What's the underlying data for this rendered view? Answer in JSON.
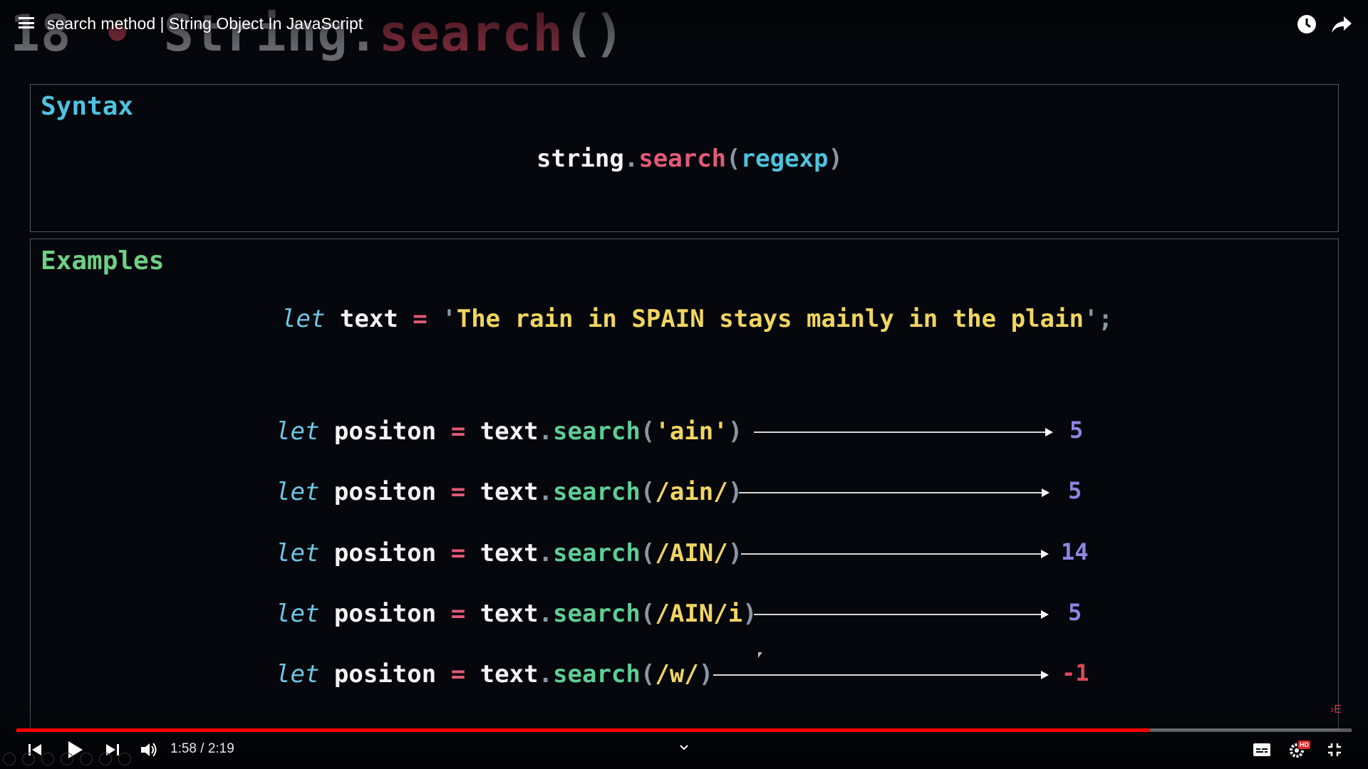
{
  "slide": {
    "heading_num": "18",
    "heading_dot": "•",
    "heading_obj": "String.",
    "heading_method": "search",
    "heading_paren": "()"
  },
  "player": {
    "title": "search method | String Object In JavaScript",
    "time": "1:58 / 2:19",
    "progress_fraction": 0.849,
    "hd_badge": "HD",
    "accent": "#ff0000"
  },
  "syntax": {
    "title": "Syntax",
    "obj": "string",
    "dot": ".",
    "method": "search",
    "open": "(",
    "arg": "regexp",
    "close": ")"
  },
  "examples": {
    "title": "Examples",
    "decl": {
      "kw": "let",
      "name": "text",
      "eq": "=",
      "q1": "'",
      "str": "The rain in SPAIN stays mainly in the plain",
      "q2": "'",
      "semi": ";"
    },
    "lines": [
      {
        "kw": "let",
        "var": "positon",
        "eq": "=",
        "obj": "text",
        "dot": ".",
        "method": "search",
        "open": "(",
        "arg": "'ain'",
        "close": ")",
        "result": "5"
      },
      {
        "kw": "let",
        "var": "positon",
        "eq": "=",
        "obj": "text",
        "dot": ".",
        "method": "search",
        "open": "(",
        "arg": "/ain/",
        "close": ")",
        "result": "5"
      },
      {
        "kw": "let",
        "var": "positon",
        "eq": "=",
        "obj": "text",
        "dot": ".",
        "method": "search",
        "open": "(",
        "arg": "/AIN/",
        "close": ")",
        "result": "14"
      },
      {
        "kw": "let",
        "var": "positon",
        "eq": "=",
        "obj": "text",
        "dot": ".",
        "method": "search",
        "open": "(",
        "arg": "/AIN/i",
        "close": ")",
        "result": "5"
      },
      {
        "kw": "let",
        "var": "positon",
        "eq": "=",
        "obj": "text",
        "dot": ".",
        "method": "search",
        "open": "(",
        "arg": "/w/",
        "close": ")",
        "result": "-1"
      }
    ]
  },
  "side_marker": "›E",
  "icons": [
    "menu-icon",
    "watch-later-icon",
    "share-icon",
    "skip-previous-icon",
    "play-icon",
    "skip-next-icon",
    "volume-icon",
    "chevron-down-icon",
    "subtitles-icon",
    "settings-icon",
    "exit-fullscreen-icon"
  ]
}
